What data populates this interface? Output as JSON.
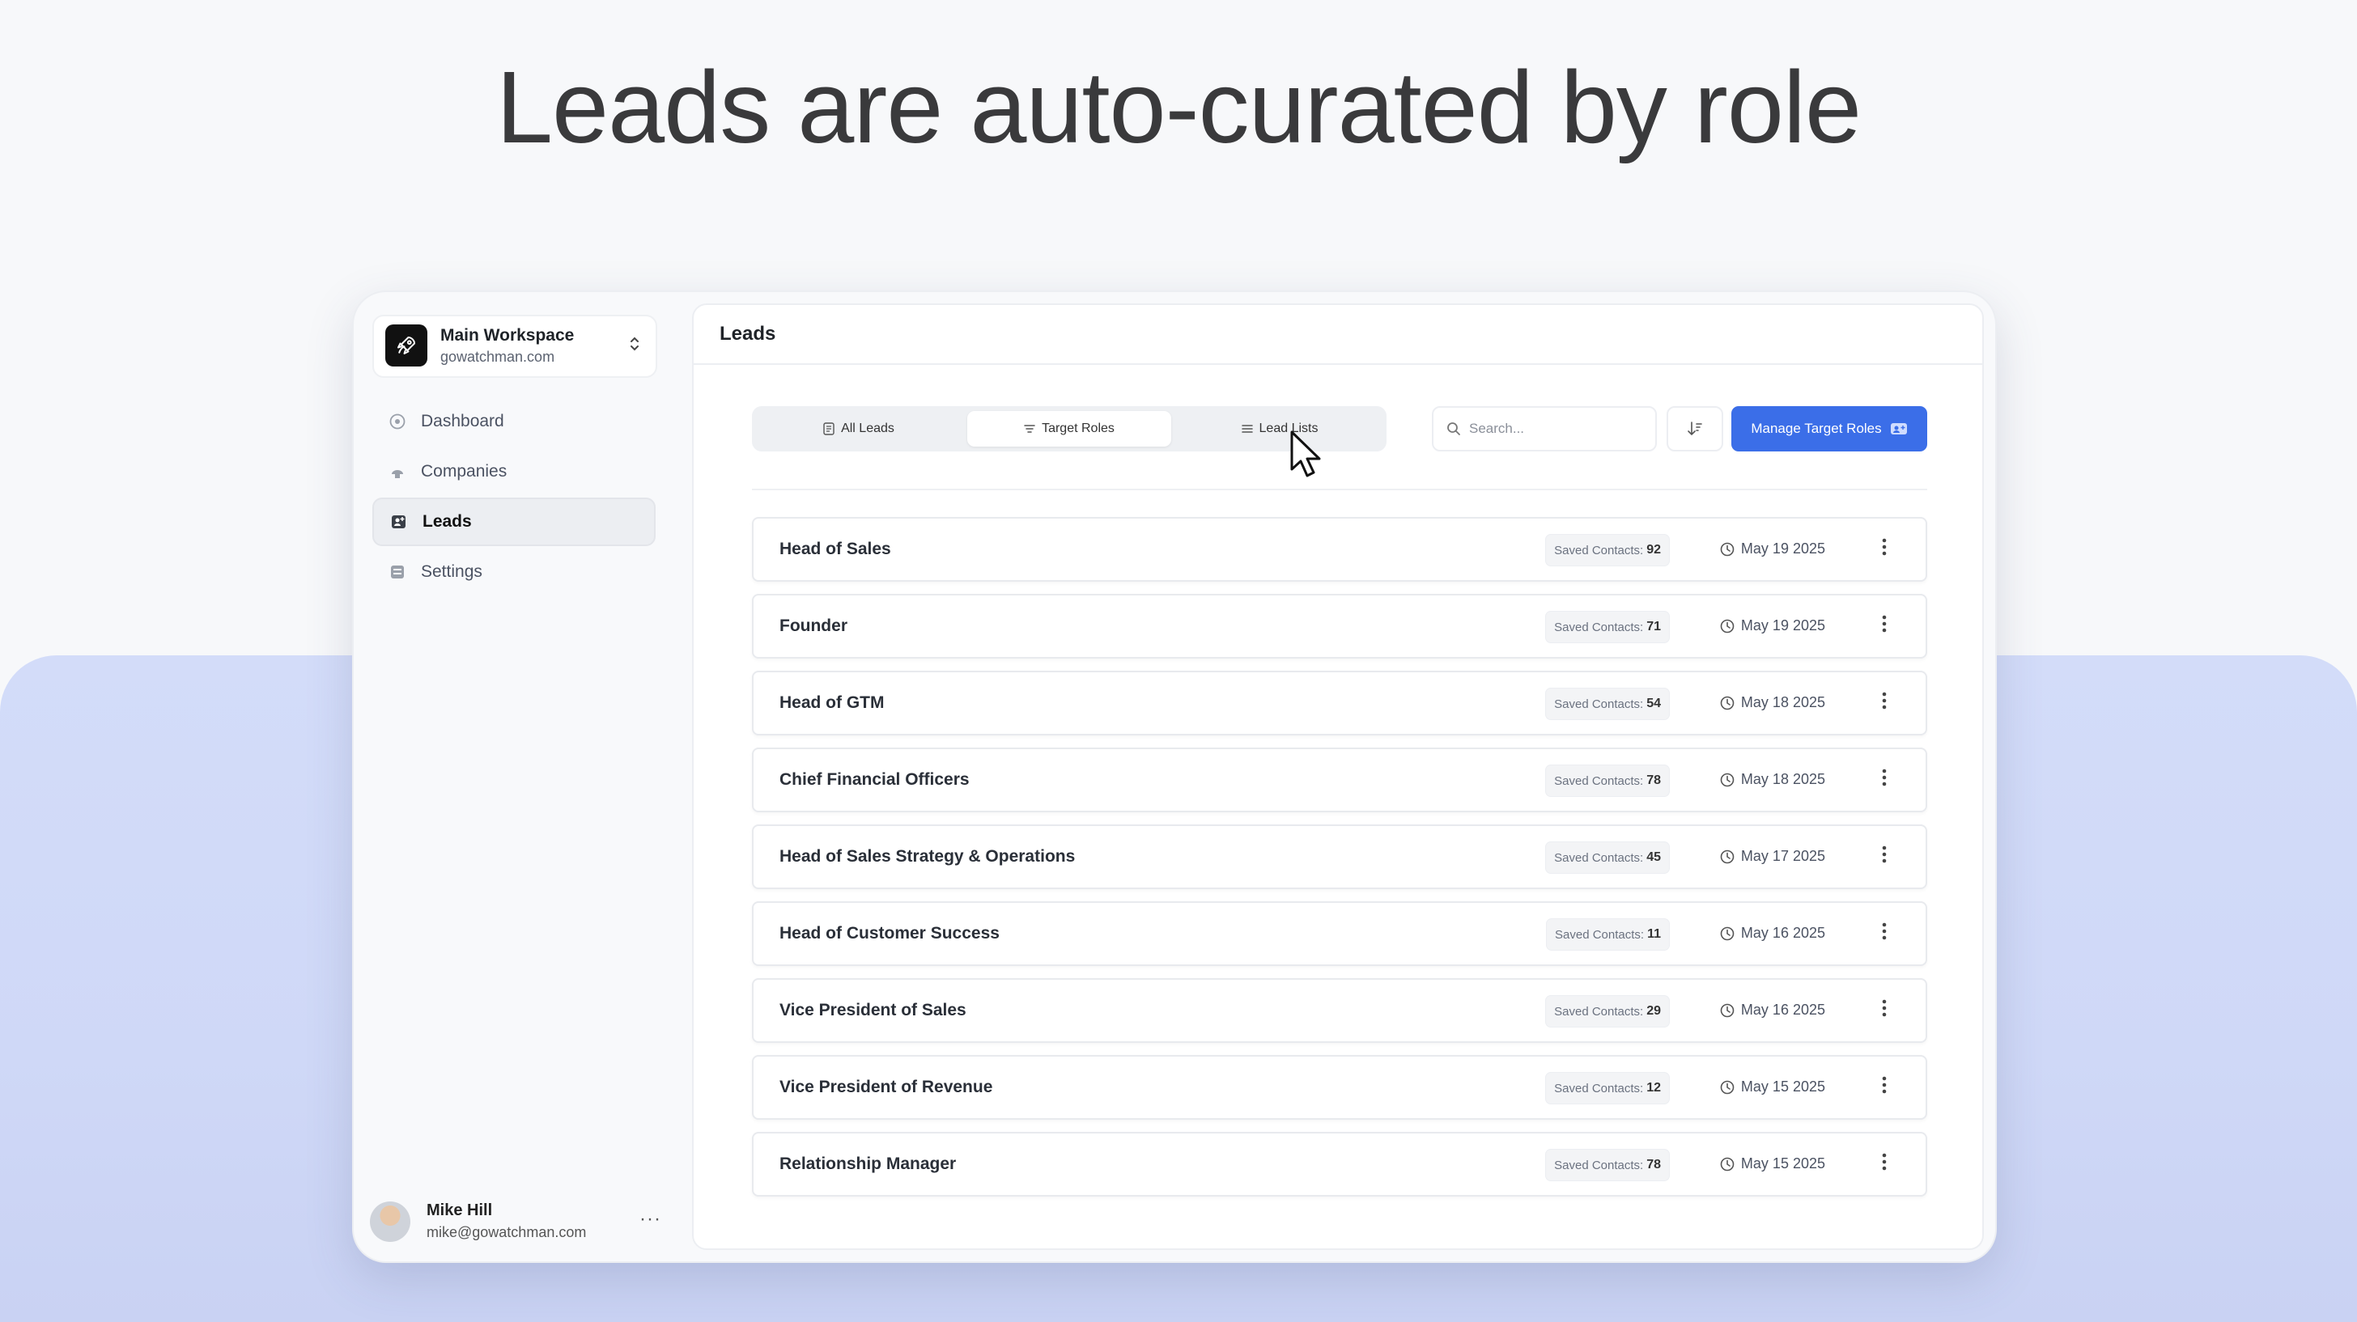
{
  "headline": "Leads are auto-curated by role",
  "workspace": {
    "name": "Main Workspace",
    "domain": "gowatchman.com",
    "logo_icon": "rocket-icon"
  },
  "nav": [
    {
      "label": "Dashboard",
      "icon": "dashboard-icon",
      "active": false
    },
    {
      "label": "Companies",
      "icon": "companies-icon",
      "active": false
    },
    {
      "label": "Leads",
      "icon": "leads-icon",
      "active": true
    },
    {
      "label": "Settings",
      "icon": "settings-icon",
      "active": false
    }
  ],
  "user": {
    "name": "Mike Hill",
    "email": "mike@gowatchman.com",
    "more": "···"
  },
  "page": {
    "title": "Leads"
  },
  "tabs": [
    {
      "label": "All Leads",
      "active": false
    },
    {
      "label": "Target Roles",
      "active": true
    },
    {
      "label": "Lead Lists",
      "active": false
    }
  ],
  "search": {
    "placeholder": "Search..."
  },
  "manage_button": {
    "label": "Manage Target Roles"
  },
  "saved_contacts_label": "Saved Contacts:",
  "roles": [
    {
      "title": "Head of Sales",
      "saved": "92",
      "date": "May 19 2025"
    },
    {
      "title": "Founder",
      "saved": "71",
      "date": "May 19 2025"
    },
    {
      "title": "Head of GTM",
      "saved": "54",
      "date": "May 18 2025"
    },
    {
      "title": "Chief Financial Officers",
      "saved": "78",
      "date": "May 18 2025"
    },
    {
      "title": "Head of Sales Strategy & Operations",
      "saved": "45",
      "date": "May 17 2025"
    },
    {
      "title": "Head of Customer Success",
      "saved": "11",
      "date": "May 16 2025"
    },
    {
      "title": "Vice President of Sales",
      "saved": "29",
      "date": "May 16 2025"
    },
    {
      "title": "Vice President of Revenue",
      "saved": "12",
      "date": "May 15 2025"
    },
    {
      "title": "Relationship Manager",
      "saved": "78",
      "date": "May 15 2025"
    }
  ],
  "colors": {
    "accent": "#3b6ee8",
    "band": "#d3dcf9",
    "background": "#f7f8fa"
  }
}
